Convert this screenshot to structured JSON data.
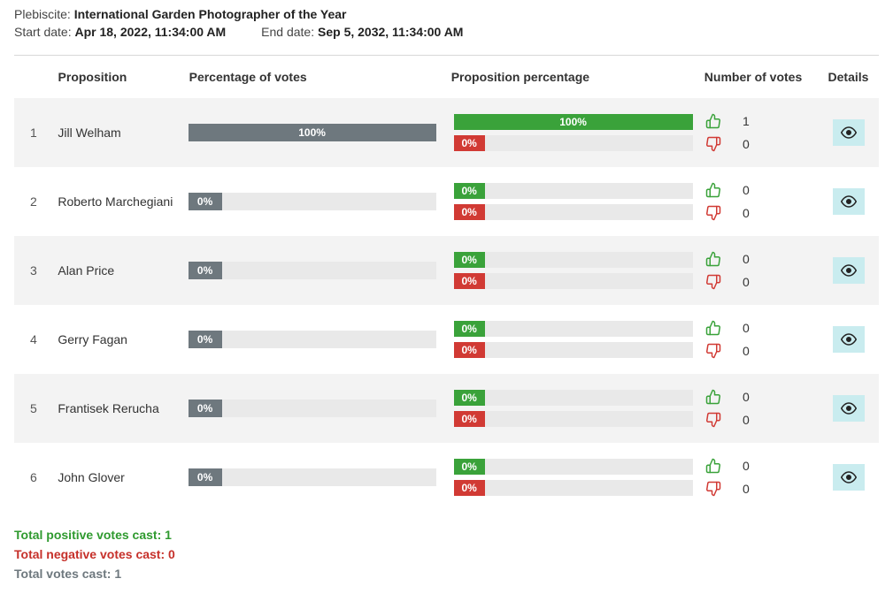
{
  "header": {
    "plebiscite_label": "Plebiscite:",
    "plebiscite_name": "International Garden Photographer of the Year",
    "start_label": "Start date:",
    "start_value": "Apr 18, 2022, 11:34:00 AM",
    "end_label": "End date:",
    "end_value": "Sep 5, 2032, 11:34:00 AM"
  },
  "columns": {
    "proposition": "Proposition",
    "pct_votes": "Percentage of votes",
    "prop_pct": "Proposition percentage",
    "num_votes": "Number of votes",
    "details": "Details"
  },
  "rows": [
    {
      "idx": "1",
      "name": "Jill Welham",
      "pct": "100%",
      "pct_width": 100,
      "pos_pct": "100%",
      "pos_width": 100,
      "neg_pct": "0%",
      "neg_width": 0,
      "pos_votes": "1",
      "neg_votes": "0"
    },
    {
      "idx": "2",
      "name": "Roberto Marchegiani",
      "pct": "0%",
      "pct_width": 0,
      "pos_pct": "0%",
      "pos_width": 0,
      "neg_pct": "0%",
      "neg_width": 0,
      "pos_votes": "0",
      "neg_votes": "0"
    },
    {
      "idx": "3",
      "name": "Alan Price",
      "pct": "0%",
      "pct_width": 0,
      "pos_pct": "0%",
      "pos_width": 0,
      "neg_pct": "0%",
      "neg_width": 0,
      "pos_votes": "0",
      "neg_votes": "0"
    },
    {
      "idx": "4",
      "name": "Gerry Fagan",
      "pct": "0%",
      "pct_width": 0,
      "pos_pct": "0%",
      "pos_width": 0,
      "neg_pct": "0%",
      "neg_width": 0,
      "pos_votes": "0",
      "neg_votes": "0"
    },
    {
      "idx": "5",
      "name": "Frantisek Rerucha",
      "pct": "0%",
      "pct_width": 0,
      "pos_pct": "0%",
      "pos_width": 0,
      "neg_pct": "0%",
      "neg_width": 0,
      "pos_votes": "0",
      "neg_votes": "0"
    },
    {
      "idx": "6",
      "name": "John Glover",
      "pct": "0%",
      "pct_width": 0,
      "pos_pct": "0%",
      "pos_width": 0,
      "neg_pct": "0%",
      "neg_width": 0,
      "pos_votes": "0",
      "neg_votes": "0"
    }
  ],
  "totals": {
    "pos": "Total positive votes cast: 1",
    "neg": "Total negative votes cast: 0",
    "all": "Total votes cast: 1"
  }
}
